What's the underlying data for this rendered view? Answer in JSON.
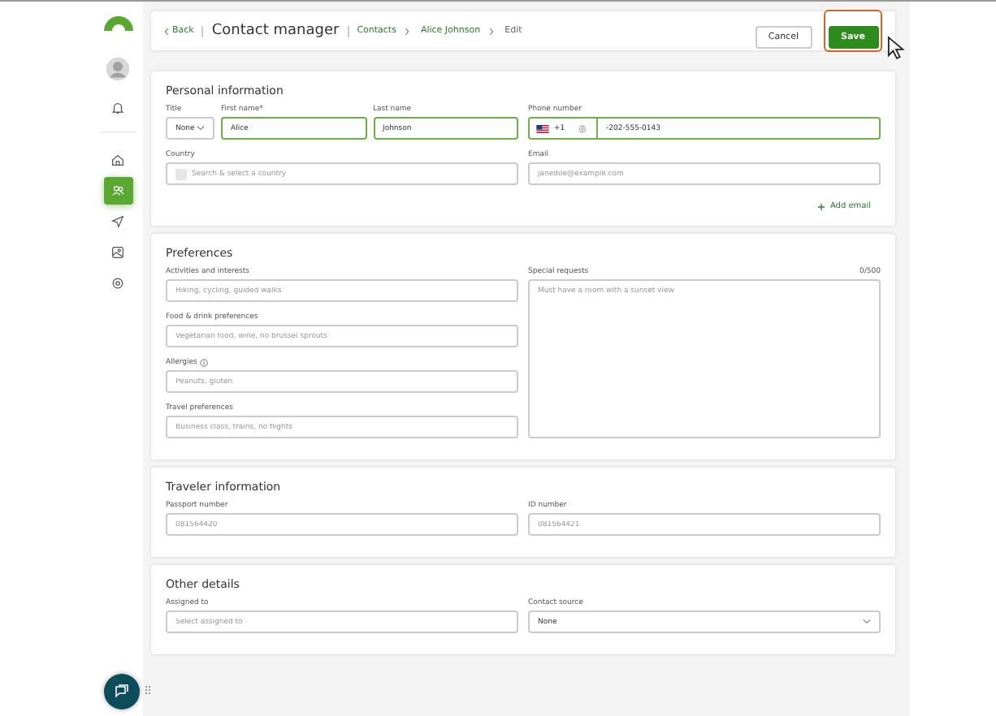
{
  "header": {
    "back": "Back",
    "title": "Contact manager",
    "breadcrumbs": [
      "Contacts",
      "Alice Johnson",
      "Edit"
    ],
    "buttons": [
      {
        "label": "Cancel",
        "kind": "secondary",
        "focused": false
      },
      {
        "label": "Save",
        "kind": "primary",
        "focused": true
      }
    ]
  },
  "sidebar": {
    "items": [
      {
        "selected": false
      },
      {
        "selected": true
      },
      {
        "selected": false
      },
      {
        "selected": false
      },
      {
        "selected": false
      }
    ]
  },
  "personal": {
    "title": "Personal information",
    "title_field": {
      "label": "Title",
      "value": "None"
    },
    "first_name": {
      "label": "First name*",
      "value": "Alice",
      "filled": true
    },
    "last_name": {
      "label": "Last name",
      "value": "Johnson",
      "filled": true
    },
    "phone": {
      "label": "Phone number",
      "code": "+1",
      "value": "-202-555-0143",
      "filled": true
    },
    "country": {
      "label": "Country",
      "placeholder": "Search & select a country",
      "filled": false
    },
    "email": {
      "label": "Email",
      "placeholder": "janedoe@example.com",
      "filled": false
    },
    "add_email": "Add email"
  },
  "preferences": {
    "title": "Preferences",
    "fields": [
      {
        "label": "Activities and interests",
        "placeholder": "Hiking, cycling, guided walks",
        "info": false
      },
      {
        "label": "Food & drink preferences",
        "placeholder": "Vegetarian food, wine, no brussel sprouts",
        "info": false
      },
      {
        "label": "Allergies",
        "placeholder": "Peanuts, gluten",
        "info": true
      },
      {
        "label": "Travel preferences",
        "placeholder": "Business class, trains, no flights",
        "info": false
      }
    ],
    "special": {
      "label": "Special requests",
      "counter": "0/500",
      "placeholder": "Must have a room with a sunset view"
    }
  },
  "traveler": {
    "title": "Traveler information",
    "fields": [
      {
        "label": "Passport number",
        "placeholder": "081564420"
      },
      {
        "label": "ID number",
        "placeholder": "081564421"
      }
    ]
  },
  "other": {
    "title": "Other details",
    "assigned": {
      "label": "Assigned to",
      "placeholder": "Select assigned to"
    },
    "source": {
      "label": "Contact source",
      "value": "None"
    }
  }
}
